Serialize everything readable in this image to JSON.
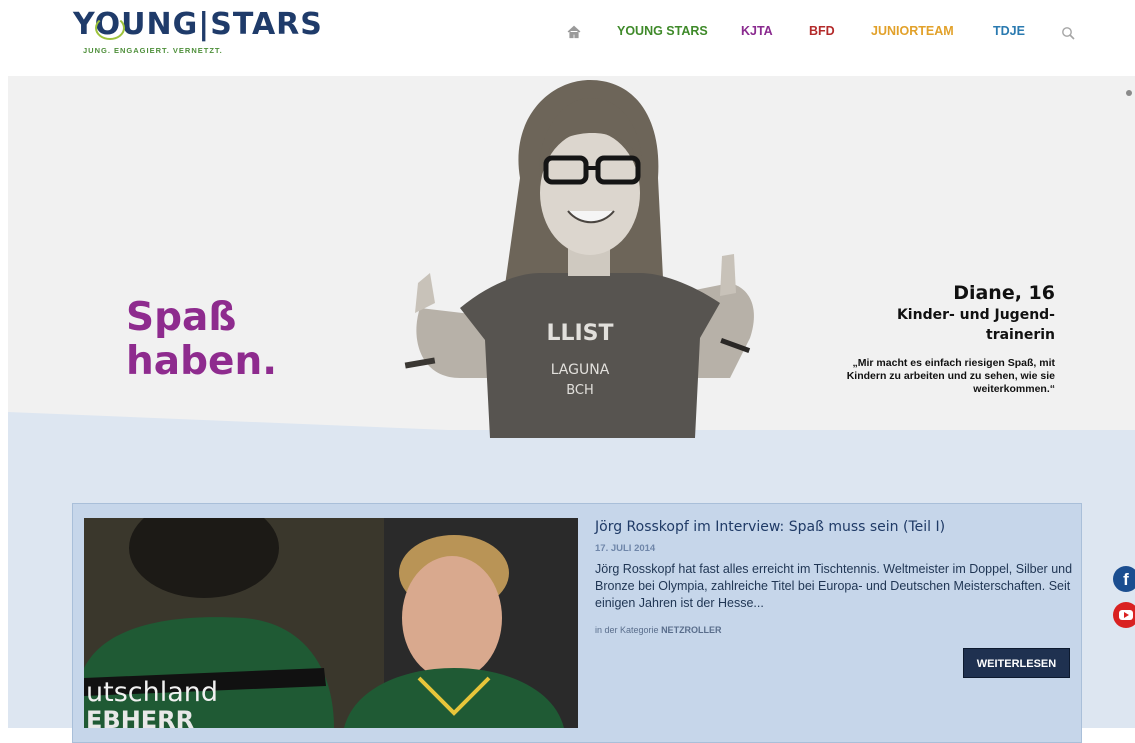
{
  "logo": {
    "text": "YOUNG|STARS",
    "tagline": "JUNG. ENGAGIERT. VERNETZT."
  },
  "nav": {
    "items": [
      {
        "label": "YOUNG STARS",
        "color": "#3f8a2a"
      },
      {
        "label": "KJTA",
        "color": "#8a2a8f"
      },
      {
        "label": "BFD",
        "color": "#b32a2a"
      },
      {
        "label": "JUNIORTEAM",
        "color": "#e2a12a"
      },
      {
        "label": "TDJE",
        "color": "#2a7ab0"
      }
    ],
    "home_icon": "home-icon",
    "search_icon": "search-icon"
  },
  "hero": {
    "slogan_line1": "Spaß",
    "slogan_line2": "haben.",
    "person_name": "Diane, 16",
    "person_role_line1": "Kinder- und Jugend-",
    "person_role_line2": "trainerin",
    "quote": "„Mir macht es einfach riesigen Spaß, mit Kindern zu arbeiten und zu sehen, wie sie weiterkommen.“",
    "shirt_text_1": "LLIST",
    "shirt_text_2": "LAGUNA",
    "shirt_text_3": "BCH"
  },
  "article": {
    "title": "Jörg Rosskopf im Interview: Spaß muss sein (Teil I)",
    "date": "17. JULI 2014",
    "excerpt": "Jörg Rosskopf hat fast alles erreicht im Tischtennis. Weltmeister im Doppel, Silber und Bronze bei Olympia, zahlreiche Titel bei Europa- und Deutschen Meisterschaften. Seit einigen Jahren ist der Hesse...",
    "category_prefix": "in der Kategorie",
    "category": "NETZROLLER",
    "read_more": "WEITERLESEN",
    "image_text_1": "utschland",
    "image_text_2": "EBHERR"
  },
  "social": {
    "facebook": "f",
    "youtube": "youtube-icon"
  }
}
